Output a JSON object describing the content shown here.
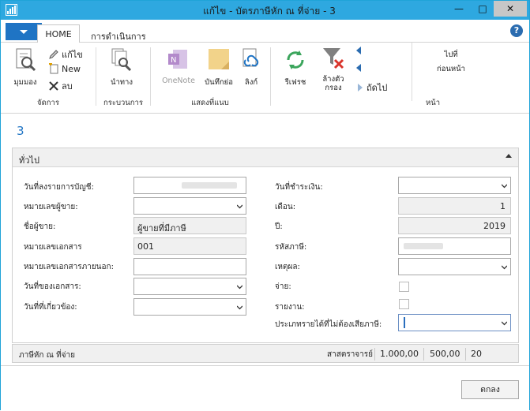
{
  "window": {
    "title": "แก้ไข - บัตรภาษีหัก ณ ที่จ่าย - 3",
    "minimize": "—",
    "maximize": "□",
    "close": "✕"
  },
  "ribbon": {
    "tabs": [
      {
        "label": "HOME"
      },
      {
        "label": "การดำเนินการ"
      }
    ],
    "help": "?",
    "groups": {
      "manage": {
        "label": "จัดการ",
        "view": "มุมมอง",
        "edit": "แก้ไข",
        "new": "New",
        "delete": "ลบ"
      },
      "process": {
        "label": "กระบวนการ",
        "navigate": "นำทาง"
      },
      "show_attached": {
        "label": "แสดงที่แนบ",
        "onenote": "OneNote",
        "notes": "บันทึกย่อ",
        "links": "ลิงก์"
      },
      "page": {
        "label": "หน้า",
        "refresh": "รีเฟรช",
        "clear_filter": "ล้างตัวกรอง",
        "next": "ถัดไป",
        "go_to": "ไปที่",
        "previous_page": "ก่อนหน้า"
      }
    }
  },
  "page": {
    "title": "3",
    "general_tab": {
      "title": "ทั่วไป",
      "left_fields": [
        {
          "label": "วันที่ลงรายการบัญชี:",
          "value": ""
        },
        {
          "label": "หมายเลขผู้ขาย:",
          "value": ""
        },
        {
          "label": "ชื่อผู้ขาย:",
          "value": "ผู้ขายที่มีภาษี"
        },
        {
          "label": "หมายเลขเอกสาร",
          "value": "001"
        },
        {
          "label": "หมายเลขเอกสารภายนอก:",
          "value": ""
        },
        {
          "label": "วันที่ของเอกสาร:",
          "value": ""
        },
        {
          "label": "วันที่ที่เกี่ยวข้อง:",
          "value": ""
        }
      ],
      "right_fields": [
        {
          "label": "วันที่ชำระเงิน:",
          "value": ""
        },
        {
          "label": "เดือน:",
          "value": "1"
        },
        {
          "label": "ปี:",
          "value": "2019"
        },
        {
          "label": "รหัสภาษี:",
          "value": ""
        },
        {
          "label": "เหตุผล:",
          "value": ""
        },
        {
          "label": "จ่าย:",
          "value": ""
        },
        {
          "label": "รายงาน:",
          "value": ""
        },
        {
          "label": "ประเภทรายได้ที่ไม่ต้องเสียภาษี:",
          "value": ""
        }
      ]
    },
    "wht_tab": {
      "title": "ภาษีหัก ณ ที่จ่าย",
      "summary_label": "สาสตราจารย์",
      "values": [
        "1.000,00",
        "500,00",
        "20"
      ]
    },
    "ok_button": "ตกลง"
  }
}
